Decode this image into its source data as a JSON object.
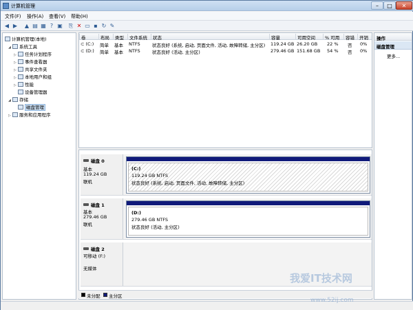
{
  "window": {
    "title": "计算机管理"
  },
  "menu": {
    "file": "文件(F)",
    "action": "操作(A)",
    "view": "查看(V)",
    "help": "帮助(H)"
  },
  "tree": {
    "root": "计算机管理(本地)",
    "system_tools": "系统工具",
    "task_scheduler": "任务计划程序",
    "event_viewer": "事件查看器",
    "shared_folders": "共享文件夹",
    "local_users": "本地用户和组",
    "performance": "性能",
    "device_manager": "设备管理器",
    "storage": "存储",
    "disk_management": "磁盘管理",
    "services_apps": "服务和应用程序"
  },
  "volume_table": {
    "headers": [
      "卷",
      "布局",
      "类型",
      "文件系统",
      "状态",
      "容量",
      "可用空间",
      "% 可用",
      "容错",
      "开销"
    ],
    "rows": [
      [
        "(C:)",
        "简单",
        "基本",
        "NTFS",
        "状态良好 (系统, 启动, 页面文件, 活动, 故障转储, 主分区)",
        "119.24 GB",
        "26.20 GB",
        "22 %",
        "否",
        "0%"
      ],
      [
        "(D:)",
        "简单",
        "基本",
        "NTFS",
        "状态良好 (活动, 主分区)",
        "279.46 GB",
        "151.68 GB",
        "54 %",
        "否",
        "0%"
      ]
    ]
  },
  "disks": [
    {
      "name": "磁盘 0",
      "type": "基本",
      "size": "119.24 GB",
      "status": "联机",
      "partition": {
        "name": "(C:)",
        "size": "119.24 GB NTFS",
        "status": "状态良好 (系统, 启动, 页面文件, 活动, 故障转储, 主分区)"
      }
    },
    {
      "name": "磁盘 1",
      "type": "基本",
      "size": "279.46 GB",
      "status": "联机",
      "partition": {
        "name": "(D:)",
        "size": "279.46 GB NTFS",
        "status": "状态良好 (活动, 主分区)"
      }
    },
    {
      "name": "磁盘 2",
      "type": "可移动 (F:)",
      "size": "",
      "status": "无媒体"
    }
  ],
  "legend": {
    "unallocated": "未分配",
    "primary": "主分区",
    "unallocated_color": "#000000",
    "primary_color": "#101a7a"
  },
  "actions": {
    "header": "操作",
    "section": "磁盘管理",
    "more": "更多..."
  },
  "watermark": {
    "text": "我爱IT技术网",
    "url": "www.52ij.com"
  }
}
